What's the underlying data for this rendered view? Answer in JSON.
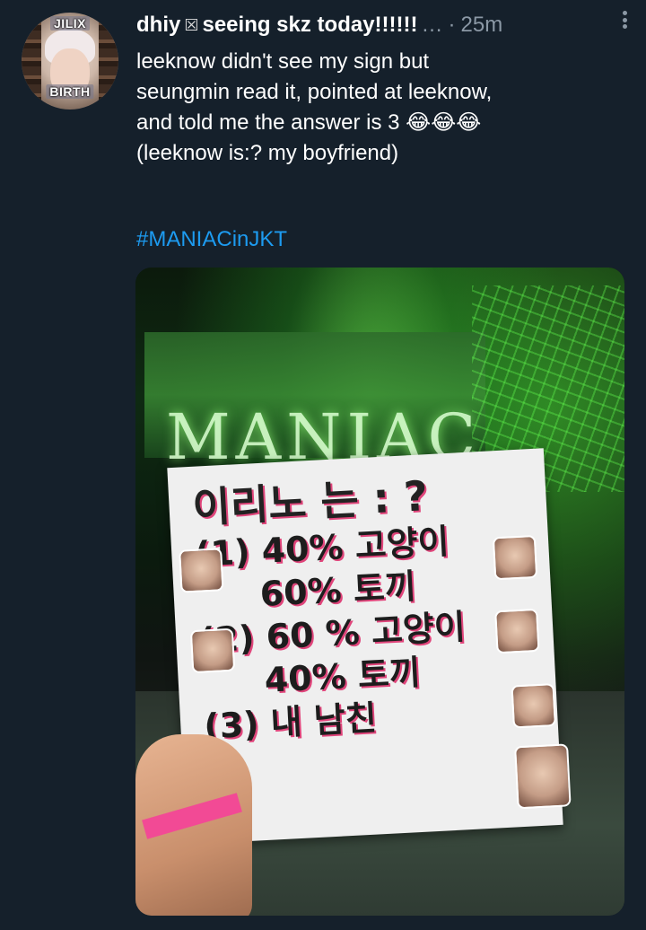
{
  "avatar": {
    "top_tag": "JILIX",
    "bottom_tag": "BIRTH"
  },
  "header": {
    "display_name": "dhiy",
    "name_emoji": "☒",
    "name_suffix": "seeing skz today!!!!!!",
    "ellipsis": "…",
    "separator": "·",
    "time": "25m",
    "more_icon": "more-vertical-icon"
  },
  "tweet": {
    "lines": [
      "leeknow didn't see my sign but",
      "seungmin read it, pointed at leeknow,",
      "and told me the answer is 3",
      "(leeknow is:? my boyfriend)"
    ],
    "emoji": "😂😂😂",
    "hashtag": "#MANIACinJKT"
  },
  "media": {
    "stage_logo": "MANIAC",
    "sign": {
      "line1": "이리노 는 : ?",
      "line2": "(1) 40% 고양이",
      "line3": "60% 토끼",
      "line4": "(2) 60 % 고양이",
      "line5": "40% 토끼",
      "line6": "(3) 내 남친"
    }
  },
  "colors": {
    "background": "#15202b",
    "text": "#ffffff",
    "secondary": "#8b98a5",
    "link": "#1d9bf0"
  }
}
